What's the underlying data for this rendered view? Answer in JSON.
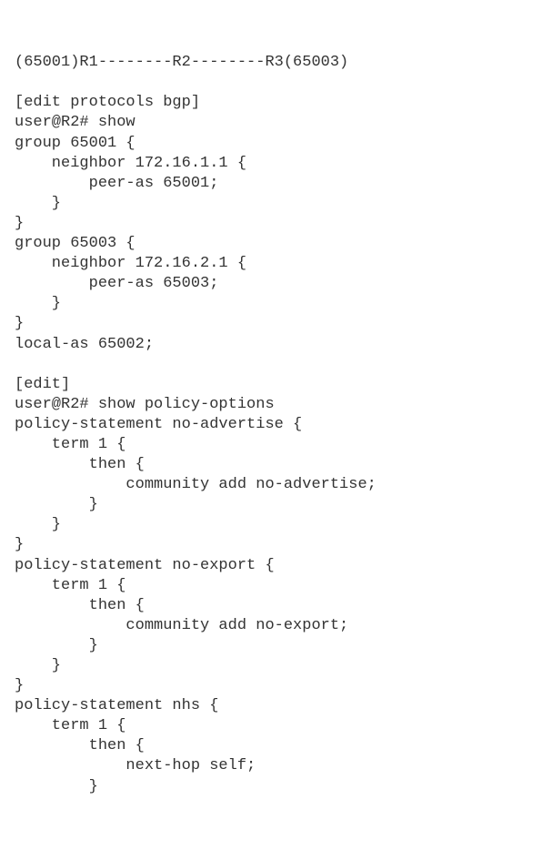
{
  "lines": [
    "(65001)R1--------R2--------R3(65003)",
    "",
    "[edit protocols bgp]",
    "user@R2# show",
    "group 65001 {",
    "    neighbor 172.16.1.1 {",
    "        peer-as 65001;",
    "    }",
    "}",
    "group 65003 {",
    "    neighbor 172.16.2.1 {",
    "        peer-as 65003;",
    "    }",
    "}",
    "local-as 65002;",
    "",
    "[edit]",
    "user@R2# show policy-options",
    "policy-statement no-advertise {",
    "    term 1 {",
    "        then {",
    "            community add no-advertise;",
    "        }",
    "    }",
    "}",
    "policy-statement no-export {",
    "    term 1 {",
    "        then {",
    "            community add no-export;",
    "        }",
    "    }",
    "}",
    "policy-statement nhs {",
    "    term 1 {",
    "        then {",
    "            next-hop self;",
    "        }"
  ]
}
